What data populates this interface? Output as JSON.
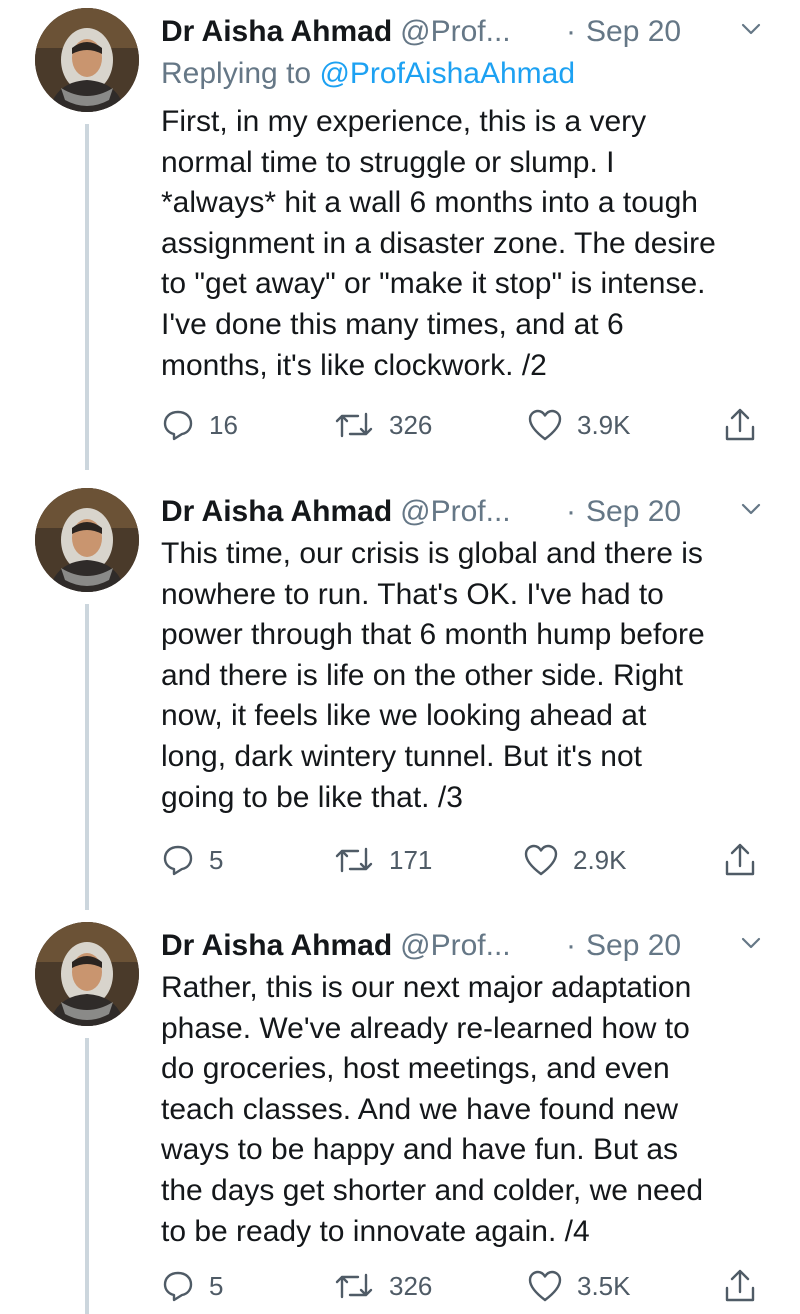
{
  "tweets": [
    {
      "name": "Dr Aisha Ahmad",
      "handle": "@Prof...",
      "separator": "·",
      "date": "Sep 20",
      "replying_prefix": "Replying to",
      "replying_handle": "@ProfAishaAhmad",
      "text": "First, in my experience, this is a very\nnormal time to struggle or slump. I\n*always* hit a wall 6 months into a tough\nassignment in a disaster zone. The desire\nto \"get away\" or \"make it stop\" is intense.\nI've done this many times, and at 6\nmonths, it's like clockwork. /2",
      "replies": "16",
      "retweets": "326",
      "likes": "3.9K"
    },
    {
      "name": "Dr Aisha Ahmad",
      "handle": "@Prof...",
      "separator": "·",
      "date": "Sep 20",
      "text": "This time, our crisis is global and there is\nnowhere to run. That's OK. I've had to\npower through that 6 month hump before\nand there is life on the other side. Right\nnow, it feels like we looking ahead at\nlong, dark wintery tunnel. But it's not\ngoing to be like that. /3",
      "replies": "5",
      "retweets": "171",
      "likes": "2.9K"
    },
    {
      "name": "Dr Aisha Ahmad",
      "handle": "@Prof...",
      "separator": "·",
      "date": "Sep 20",
      "text": "Rather, this is our next major adaptation\nphase. We've already re-learned how to\ndo groceries, host meetings, and even\nteach classes. And we have found new\nways to be happy and have fun. But as\nthe days get shorter and colder, we need\nto be ready to innovate again. /4",
      "replies": "5",
      "retweets": "326",
      "likes": "3.5K"
    }
  ],
  "icons": {
    "reply": "reply-icon",
    "retweet": "retweet-icon",
    "like": "heart-icon",
    "share": "share-icon",
    "menu": "chevron-down-icon"
  },
  "colors": {
    "text": "#14171a",
    "secondary": "#657786",
    "link": "#1da1f2",
    "thread_line": "#ccd6dd",
    "icon": "#4f5b66"
  }
}
